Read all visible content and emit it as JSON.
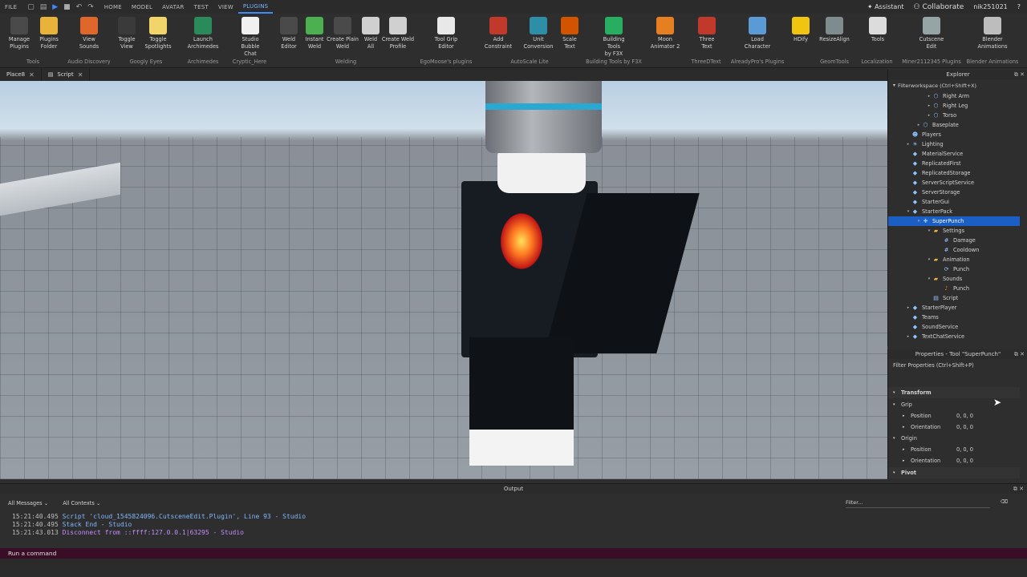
{
  "menubar": {
    "items": [
      "FILE",
      "HOME",
      "MODEL",
      "AVATAR",
      "TEST",
      "VIEW",
      "PLUGINS"
    ],
    "active": "PLUGINS",
    "assistant": "Assistant",
    "collaborate": "Collaborate",
    "username": "nik251021"
  },
  "ribbon": {
    "buttons": [
      {
        "label": "Manage\nPlugins",
        "icon": "gear-plugins-icon",
        "color": "#4a4a4a"
      },
      {
        "label": "Plugins\nFolder",
        "icon": "folder-icon",
        "color": "#e8b33a"
      },
      {
        "label": "View\nSounds",
        "icon": "speaker-icon",
        "color": "#e0672b"
      },
      {
        "label": "Toggle\nView",
        "icon": "eyes-icon",
        "color": "#3a3a3a"
      },
      {
        "label": "Toggle\nSpotlights",
        "icon": "bulb-icon",
        "color": "#f1d46a"
      },
      {
        "label": "Launch\nArchimedes",
        "icon": "archimedes-icon",
        "color": "#2a8a5a"
      },
      {
        "label": "Studio Bubble\nChat",
        "icon": "chat-bubble-icon",
        "color": "#f0f0f0"
      },
      {
        "label": "Weld\nEditor",
        "icon": "weld-editor-icon",
        "color": "#4a4a4a"
      },
      {
        "label": "Instant\nWeld",
        "icon": "instant-weld-icon",
        "color": "#4caf50"
      },
      {
        "label": "Create Plain\nWeld",
        "icon": "plain-weld-icon",
        "color": "#4a4a4a"
      },
      {
        "label": "Weld\nAll",
        "icon": "weld-all-icon",
        "color": "#d0d0d0"
      },
      {
        "label": "Create Weld\nProfile",
        "icon": "weld-profile-icon",
        "color": "#d0d0d0"
      },
      {
        "label": "Tool Grip\nEditor",
        "icon": "tool-grip-icon",
        "color": "#e8e8e8"
      },
      {
        "label": "Add\nConstraint",
        "icon": "constraint-icon",
        "color": "#c0392b"
      },
      {
        "label": "Unit\nConversion",
        "icon": "unit-conversion-icon",
        "color": "#2e8ea8"
      },
      {
        "label": "Scale\nText",
        "icon": "scale-text-icon",
        "color": "#d35400"
      },
      {
        "label": "Building Tools\nby F3X",
        "icon": "f3x-icon",
        "color": "#27ae60"
      },
      {
        "label": "Moon\nAnimator 2",
        "icon": "moon-icon",
        "color": "#e67e22"
      },
      {
        "label": "Three\nText",
        "icon": "3d-text-icon",
        "color": "#c0392b"
      },
      {
        "label": "Load\nCharacter",
        "icon": "load-character-icon",
        "color": "#5a9bd5"
      },
      {
        "label": "HDify",
        "icon": "hdify-icon",
        "color": "#f1c40f"
      },
      {
        "label": "ResizeAlign",
        "icon": "resize-align-icon",
        "color": "#7f8c8d"
      },
      {
        "label": "Tools",
        "icon": "globe-tools-icon",
        "color": "#dcdcdc"
      },
      {
        "label": "Cutscene\nEdit",
        "icon": "cutscene-icon",
        "color": "#95a5a6"
      },
      {
        "label": "Blender\nAnimations",
        "icon": "blender-icon",
        "color": "#bdbdbd"
      }
    ],
    "groups": [
      "Tools",
      "Audio Discovery",
      "Googly Eyes",
      "Archimedes",
      "Cryptic_Here",
      "Welding",
      "EgoMoose's plugins",
      "AutoScale Lite",
      "Building Tools by F3X",
      "ThreeDText",
      "AlreadyPro's Plugins",
      "GeomTools",
      "Localization",
      "Miner2112345 Plugins",
      "Blender Animations"
    ]
  },
  "tabs": [
    {
      "label": "Place8"
    },
    {
      "label": "Script"
    }
  ],
  "explorer": {
    "title": "Explorer",
    "filter": "Filterworkspace (Ctrl+Shift+X)",
    "items": [
      {
        "label": "Right Arm",
        "depth": 3,
        "arrow": "▸",
        "icon": "part-icon"
      },
      {
        "label": "Right Leg",
        "depth": 3,
        "arrow": "▸",
        "icon": "part-icon"
      },
      {
        "label": "Torso",
        "depth": 3,
        "arrow": "▸",
        "icon": "part-icon"
      },
      {
        "label": "Baseplate",
        "depth": 2,
        "arrow": "▸",
        "icon": "part-icon"
      },
      {
        "label": "Players",
        "depth": 1,
        "arrow": "",
        "icon": "players-icon"
      },
      {
        "label": "Lighting",
        "depth": 1,
        "arrow": "▸",
        "icon": "lighting-icon"
      },
      {
        "label": "MaterialService",
        "depth": 1,
        "arrow": "",
        "icon": "material-icon"
      },
      {
        "label": "ReplicatedFirst",
        "depth": 1,
        "arrow": "",
        "icon": "replicated-first-icon"
      },
      {
        "label": "ReplicatedStorage",
        "depth": 1,
        "arrow": "",
        "icon": "replicated-storage-icon"
      },
      {
        "label": "ServerScriptService",
        "depth": 1,
        "arrow": "",
        "icon": "server-script-icon"
      },
      {
        "label": "ServerStorage",
        "depth": 1,
        "arrow": "",
        "icon": "server-storage-icon"
      },
      {
        "label": "StarterGui",
        "depth": 1,
        "arrow": "",
        "icon": "starter-gui-icon"
      },
      {
        "label": "StarterPack",
        "depth": 1,
        "arrow": "▾",
        "icon": "starter-pack-icon"
      },
      {
        "label": "SuperPunch",
        "depth": 2,
        "arrow": "▾",
        "icon": "tool-icon",
        "selected": true
      },
      {
        "label": "Settings",
        "depth": 3,
        "arrow": "▾",
        "icon": "folder-icon"
      },
      {
        "label": "Damage",
        "depth": 4,
        "arrow": "",
        "icon": "number-value-icon"
      },
      {
        "label": "Cooldown",
        "depth": 4,
        "arrow": "",
        "icon": "number-value-icon"
      },
      {
        "label": "Animation",
        "depth": 3,
        "arrow": "▾",
        "icon": "folder-icon"
      },
      {
        "label": "Punch",
        "depth": 4,
        "arrow": "",
        "icon": "animation-icon"
      },
      {
        "label": "Sounds",
        "depth": 3,
        "arrow": "▾",
        "icon": "folder-icon"
      },
      {
        "label": "Punch",
        "depth": 4,
        "arrow": "",
        "icon": "sound-icon"
      },
      {
        "label": "Script",
        "depth": 3,
        "arrow": "",
        "icon": "script-icon"
      },
      {
        "label": "StarterPlayer",
        "depth": 1,
        "arrow": "▸",
        "icon": "starter-player-icon"
      },
      {
        "label": "Teams",
        "depth": 1,
        "arrow": "",
        "icon": "teams-icon"
      },
      {
        "label": "SoundService",
        "depth": 1,
        "arrow": "",
        "icon": "sound-service-icon"
      },
      {
        "label": "TextChatService",
        "depth": 1,
        "arrow": "▸",
        "icon": "text-chat-icon"
      }
    ]
  },
  "properties": {
    "title": "Properties - Tool \"SuperPunch\"",
    "filter": "Filter Properties (Ctrl+Shift+P)",
    "rows": [
      {
        "label": "Transform",
        "value": "",
        "kind": "section",
        "arrow": "▾"
      },
      {
        "label": "Grip",
        "value": "",
        "kind": "group",
        "arrow": "▾"
      },
      {
        "label": "Position",
        "value": "0, 0, 0",
        "kind": "prop",
        "arrow": "▸"
      },
      {
        "label": "Orientation",
        "value": "0, 0, 0",
        "kind": "prop",
        "arrow": "▸"
      },
      {
        "label": "Origin",
        "value": "",
        "kind": "group",
        "arrow": "▾"
      },
      {
        "label": "Position",
        "value": "0, 0, 0",
        "kind": "prop",
        "arrow": "▸"
      },
      {
        "label": "Orientation",
        "value": "0, 0, 0",
        "kind": "prop",
        "arrow": "▸"
      },
      {
        "label": "Pivot",
        "value": "",
        "kind": "section",
        "arrow": "▾"
      }
    ]
  },
  "output": {
    "title": "Output",
    "messages_filter": "All Messages",
    "contexts_filter": "All Contexts",
    "filter_placeholder": "Filter...",
    "lines": [
      {
        "time": "15:21:40.495",
        "text": "Script 'cloud_1545824096.CutsceneEdit.Plugin', Line 93  -  Studio",
        "color": "#7fb7ff"
      },
      {
        "time": "15:21:40.495",
        "text": "Stack End  -  Studio",
        "color": "#7fb7ff"
      },
      {
        "time": "15:21:43.013",
        "text": "Disconnect from ::ffff:127.0.0.1|63295  -  Studio",
        "color": "#c58cff"
      }
    ]
  },
  "command_bar": {
    "placeholder": "Run a command"
  }
}
